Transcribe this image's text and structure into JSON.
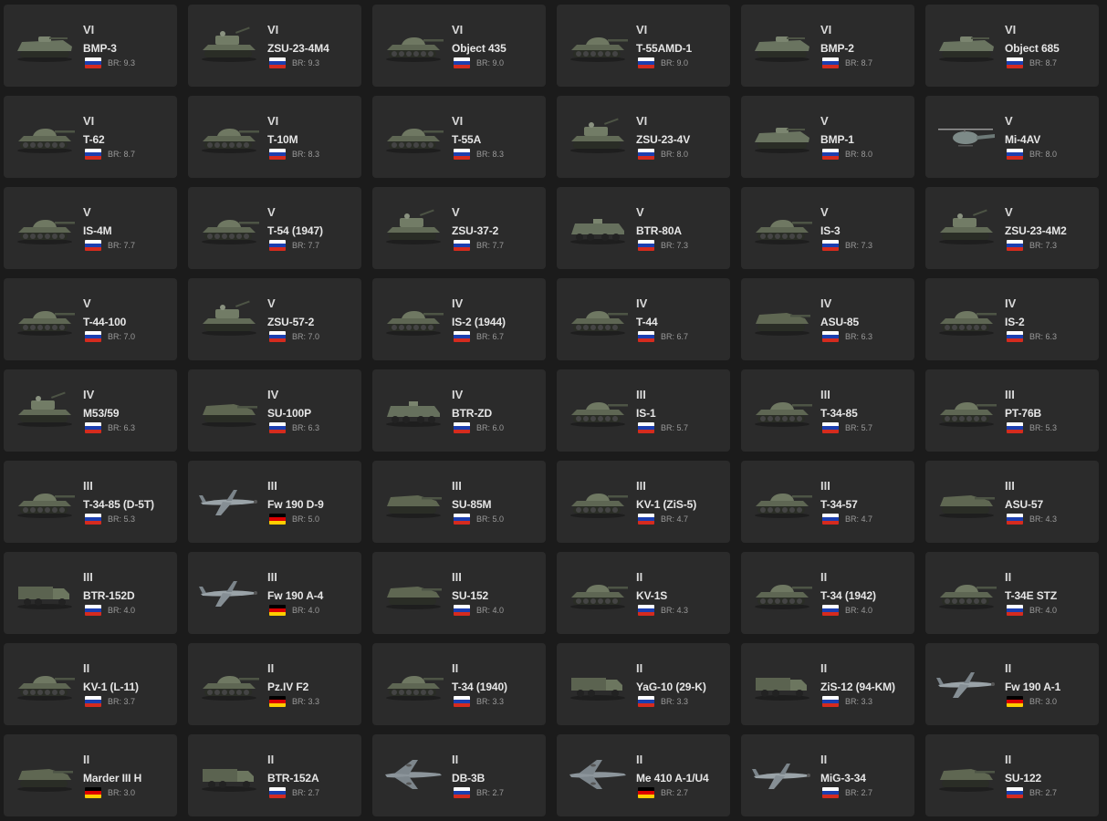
{
  "br_prefix": "BR:",
  "flag_colors": {
    "ussr": [
      "#ffffff",
      "#1c3fb0",
      "#d52b1e"
    ],
    "germany": [
      "#000000",
      "#dd0000",
      "#ffce00"
    ]
  },
  "vehicles": [
    {
      "rank": "VI",
      "name": "BMP-3",
      "nation": "ussr",
      "br": "9.3",
      "icon": "ifv-icon"
    },
    {
      "rank": "VI",
      "name": "ZSU-23-4M4",
      "nation": "ussr",
      "br": "9.3",
      "icon": "spaa-icon"
    },
    {
      "rank": "VI",
      "name": "Object 435",
      "nation": "ussr",
      "br": "9.0",
      "icon": "tank-icon"
    },
    {
      "rank": "VI",
      "name": "T-55AMD-1",
      "nation": "ussr",
      "br": "9.0",
      "icon": "tank-icon"
    },
    {
      "rank": "VI",
      "name": "BMP-2",
      "nation": "ussr",
      "br": "8.7",
      "icon": "ifv-icon"
    },
    {
      "rank": "VI",
      "name": "Object 685",
      "nation": "ussr",
      "br": "8.7",
      "icon": "ifv-icon"
    },
    {
      "rank": "VI",
      "name": "T-62",
      "nation": "ussr",
      "br": "8.7",
      "icon": "tank-icon"
    },
    {
      "rank": "VI",
      "name": "T-10M",
      "nation": "ussr",
      "br": "8.3",
      "icon": "tank-icon"
    },
    {
      "rank": "VI",
      "name": "T-55A",
      "nation": "ussr",
      "br": "8.3",
      "icon": "tank-icon"
    },
    {
      "rank": "VI",
      "name": "ZSU-23-4V",
      "nation": "ussr",
      "br": "8.0",
      "icon": "spaa-icon"
    },
    {
      "rank": "V",
      "name": "BMP-1",
      "nation": "ussr",
      "br": "8.0",
      "icon": "ifv-icon"
    },
    {
      "rank": "V",
      "name": "Mi-4AV",
      "nation": "ussr",
      "br": "8.0",
      "icon": "helicopter-icon"
    },
    {
      "rank": "V",
      "name": "IS-4M",
      "nation": "ussr",
      "br": "7.7",
      "icon": "tank-icon"
    },
    {
      "rank": "V",
      "name": "T-54 (1947)",
      "nation": "ussr",
      "br": "7.7",
      "icon": "tank-icon"
    },
    {
      "rank": "V",
      "name": "ZSU-37-2",
      "nation": "ussr",
      "br": "7.7",
      "icon": "spaa-icon"
    },
    {
      "rank": "V",
      "name": "BTR-80A",
      "nation": "ussr",
      "br": "7.3",
      "icon": "apc-icon"
    },
    {
      "rank": "V",
      "name": "IS-3",
      "nation": "ussr",
      "br": "7.3",
      "icon": "tank-icon"
    },
    {
      "rank": "V",
      "name": "ZSU-23-4M2",
      "nation": "ussr",
      "br": "7.3",
      "icon": "spaa-icon"
    },
    {
      "rank": "V",
      "name": "T-44-100",
      "nation": "ussr",
      "br": "7.0",
      "icon": "tank-icon"
    },
    {
      "rank": "V",
      "name": "ZSU-57-2",
      "nation": "ussr",
      "br": "7.0",
      "icon": "spaa-icon"
    },
    {
      "rank": "IV",
      "name": "IS-2 (1944)",
      "nation": "ussr",
      "br": "6.7",
      "icon": "tank-icon"
    },
    {
      "rank": "IV",
      "name": "T-44",
      "nation": "ussr",
      "br": "6.7",
      "icon": "tank-icon"
    },
    {
      "rank": "IV",
      "name": "ASU-85",
      "nation": "ussr",
      "br": "6.3",
      "icon": "td-icon"
    },
    {
      "rank": "IV",
      "name": "IS-2",
      "nation": "ussr",
      "br": "6.3",
      "icon": "tank-icon"
    },
    {
      "rank": "IV",
      "name": "M53/59",
      "nation": "ussr",
      "br": "6.3",
      "icon": "spaa-icon"
    },
    {
      "rank": "IV",
      "name": "SU-100P",
      "nation": "ussr",
      "br": "6.3",
      "icon": "td-icon"
    },
    {
      "rank": "IV",
      "name": "BTR-ZD",
      "nation": "ussr",
      "br": "6.0",
      "icon": "apc-icon"
    },
    {
      "rank": "III",
      "name": "IS-1",
      "nation": "ussr",
      "br": "5.7",
      "icon": "tank-icon"
    },
    {
      "rank": "III",
      "name": "T-34-85",
      "nation": "ussr",
      "br": "5.7",
      "icon": "tank-icon"
    },
    {
      "rank": "III",
      "name": "PT-76B",
      "nation": "ussr",
      "br": "5.3",
      "icon": "tank-icon"
    },
    {
      "rank": "III",
      "name": "T-34-85 (D-5T)",
      "nation": "ussr",
      "br": "5.3",
      "icon": "tank-icon"
    },
    {
      "rank": "III",
      "name": "Fw 190 D-9",
      "nation": "germany",
      "br": "5.0",
      "icon": "plane-icon"
    },
    {
      "rank": "III",
      "name": "SU-85M",
      "nation": "ussr",
      "br": "5.0",
      "icon": "td-icon"
    },
    {
      "rank": "III",
      "name": "KV-1 (ZiS-5)",
      "nation": "ussr",
      "br": "4.7",
      "icon": "tank-icon"
    },
    {
      "rank": "III",
      "name": "T-34-57",
      "nation": "ussr",
      "br": "4.7",
      "icon": "tank-icon"
    },
    {
      "rank": "III",
      "name": "ASU-57",
      "nation": "ussr",
      "br": "4.3",
      "icon": "td-icon"
    },
    {
      "rank": "III",
      "name": "BTR-152D",
      "nation": "ussr",
      "br": "4.0",
      "icon": "truck-icon"
    },
    {
      "rank": "III",
      "name": "Fw 190 A-4",
      "nation": "germany",
      "br": "4.0",
      "icon": "plane-icon"
    },
    {
      "rank": "III",
      "name": "SU-152",
      "nation": "ussr",
      "br": "4.0",
      "icon": "td-icon"
    },
    {
      "rank": "II",
      "name": "KV-1S",
      "nation": "ussr",
      "br": "4.3",
      "icon": "tank-icon"
    },
    {
      "rank": "II",
      "name": "T-34 (1942)",
      "nation": "ussr",
      "br": "4.0",
      "icon": "tank-icon"
    },
    {
      "rank": "II",
      "name": "T-34E STZ",
      "nation": "ussr",
      "br": "4.0",
      "icon": "tank-icon"
    },
    {
      "rank": "II",
      "name": "KV-1 (L-11)",
      "nation": "ussr",
      "br": "3.7",
      "icon": "tank-icon"
    },
    {
      "rank": "II",
      "name": "Pz.IV F2",
      "nation": "germany",
      "br": "3.3",
      "icon": "tank-icon"
    },
    {
      "rank": "II",
      "name": "T-34 (1940)",
      "nation": "ussr",
      "br": "3.3",
      "icon": "tank-icon"
    },
    {
      "rank": "II",
      "name": "YaG-10 (29-K)",
      "nation": "ussr",
      "br": "3.3",
      "icon": "truck-icon"
    },
    {
      "rank": "II",
      "name": "ZiS-12 (94-KM)",
      "nation": "ussr",
      "br": "3.3",
      "icon": "truck-icon"
    },
    {
      "rank": "II",
      "name": "Fw 190 A-1",
      "nation": "germany",
      "br": "3.0",
      "icon": "plane-icon"
    },
    {
      "rank": "II",
      "name": "Marder III H",
      "nation": "germany",
      "br": "3.0",
      "icon": "td-icon"
    },
    {
      "rank": "II",
      "name": "BTR-152A",
      "nation": "ussr",
      "br": "2.7",
      "icon": "truck-icon"
    },
    {
      "rank": "II",
      "name": "DB-3B",
      "nation": "ussr",
      "br": "2.7",
      "icon": "bomber-icon"
    },
    {
      "rank": "II",
      "name": "Me 410 A-1/U4",
      "nation": "germany",
      "br": "2.7",
      "icon": "bomber-icon"
    },
    {
      "rank": "II",
      "name": "MiG-3-34",
      "nation": "ussr",
      "br": "2.7",
      "icon": "plane-icon"
    },
    {
      "rank": "II",
      "name": "SU-122",
      "nation": "ussr",
      "br": "2.7",
      "icon": "td-icon"
    }
  ]
}
